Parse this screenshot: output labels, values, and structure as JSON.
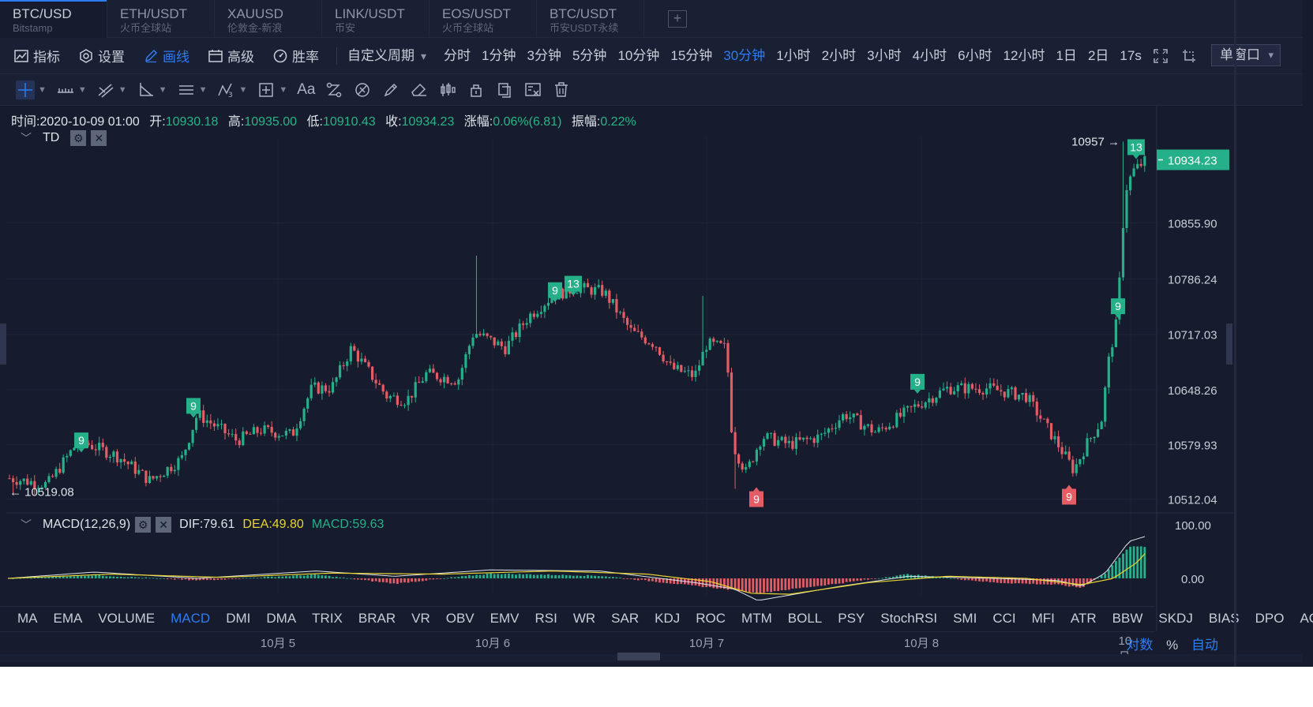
{
  "tabs": [
    {
      "name": "BTC/USD",
      "sub": "Bitstamp",
      "active": true
    },
    {
      "name": "ETH/USDT",
      "sub": "火币全球站"
    },
    {
      "name": "XAUUSD",
      "sub": "伦敦金-新浪"
    },
    {
      "name": "LINK/USDT",
      "sub": "币安"
    },
    {
      "name": "EOS/USDT",
      "sub": "火币全球站"
    },
    {
      "name": "BTC/USDT",
      "sub": "币安USDT永续"
    }
  ],
  "tab_add": "+",
  "toolbar": {
    "indicator": "指标",
    "settings": "设置",
    "draw": "画线",
    "advanced": "高级",
    "winrate": "胜率",
    "periods": [
      "自定义周期",
      "分时",
      "1分钟",
      "3分钟",
      "5分钟",
      "10分钟",
      "15分钟",
      "30分钟",
      "1小时",
      "2小时",
      "3小时",
      "4小时",
      "6小时",
      "12小时",
      "1日",
      "2日",
      "17s"
    ],
    "active_period": "30分钟",
    "single_window": "单窗口"
  },
  "drawtools": {
    "text_tool": "Aa"
  },
  "info": {
    "time_label": "时间:",
    "time": "2020-10-09 01:00",
    "open_label": "开:",
    "open": "10930.18",
    "high_label": "高:",
    "high": "10935.00",
    "low_label": "低:",
    "low": "10910.43",
    "close_label": "收:",
    "close": "10934.23",
    "change_label": "涨幅:",
    "change": "0.06%(6.81)",
    "amp_label": "振幅:",
    "amp": "0.22%"
  },
  "main_indicator": {
    "name": "TD"
  },
  "macd": {
    "name": "MACD(12,26,9)",
    "dif_label": "DIF:",
    "dif": "79.61",
    "dea_label": "DEA:",
    "dea": "49.80",
    "macd_label": "MACD:",
    "macd": "59.63",
    "axis": [
      "100.00",
      "0.00"
    ]
  },
  "colors": {
    "up": "#26b08a",
    "down": "#e45d64",
    "accent": "#2d7cf0",
    "dea": "#e8d531",
    "dif": "#dfe3ea"
  },
  "chart_data": {
    "type": "candlestick",
    "y_ticks": [
      10855.9,
      10786.24,
      10717.03,
      10648.26,
      10579.93,
      10512.04
    ],
    "y_tick_labels": [
      "10855.90",
      "10786.24",
      "10717.03",
      "10648.26",
      "10579.93",
      "10512.04"
    ],
    "last_price": "10934.23",
    "high_marker": "10957 →",
    "low_marker": "← 10519.08",
    "x_labels": [
      "10月 5",
      "10月 6",
      "10月 7",
      "10月 8",
      "10月"
    ],
    "td_marks": [
      {
        "label": "9",
        "type": "up"
      },
      {
        "label": "9",
        "type": "up"
      },
      {
        "label": "9",
        "type": "up"
      },
      {
        "label": "13",
        "type": "up"
      },
      {
        "label": "9",
        "type": "down"
      },
      {
        "label": "9",
        "type": "up"
      },
      {
        "label": "9",
        "type": "down"
      },
      {
        "label": "9",
        "type": "up"
      },
      {
        "label": "13",
        "type": "up"
      }
    ]
  },
  "indicators": [
    "MA",
    "EMA",
    "VOLUME",
    "MACD",
    "DMI",
    "DMA",
    "TRIX",
    "BRAR",
    "VR",
    "OBV",
    "EMV",
    "RSI",
    "WR",
    "SAR",
    "KDJ",
    "ROC",
    "MTM",
    "BOLL",
    "PSY",
    "StochRSI",
    "SMI",
    "CCI",
    "MFI",
    "ATR",
    "BBW",
    "SKDJ",
    "BIAS",
    "DPO",
    "AO"
  ],
  "active_indicator": "MACD",
  "axis_opts": {
    "log": "对数",
    "percent": "%",
    "auto": "自动"
  }
}
